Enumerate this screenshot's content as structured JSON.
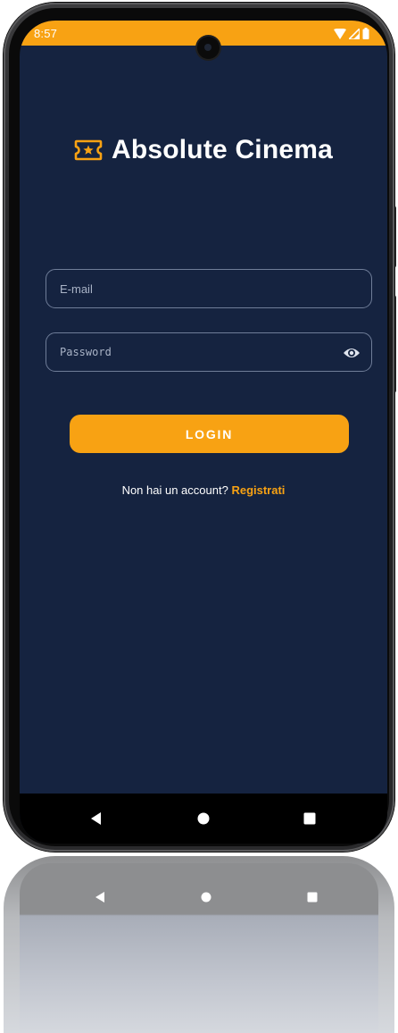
{
  "status_bar": {
    "time": "8:57",
    "accent_color": "#f8a213"
  },
  "app": {
    "title": "Absolute Cinema",
    "logo_icon": "ticket-star-icon",
    "brand_color": "#f8a213",
    "background_color": "#152340"
  },
  "login_form": {
    "email_placeholder": "E-mail",
    "email_value": "",
    "password_placeholder": "Password",
    "password_value": "",
    "password_toggle_icon": "eye-icon",
    "login_label": "LOGIN",
    "signup_prompt": "Non hai un account?",
    "signup_link": "Registrati"
  },
  "nav_bar": {
    "back_icon": "back-triangle-icon",
    "home_icon": "home-circle-icon",
    "recents_icon": "recents-square-icon"
  }
}
